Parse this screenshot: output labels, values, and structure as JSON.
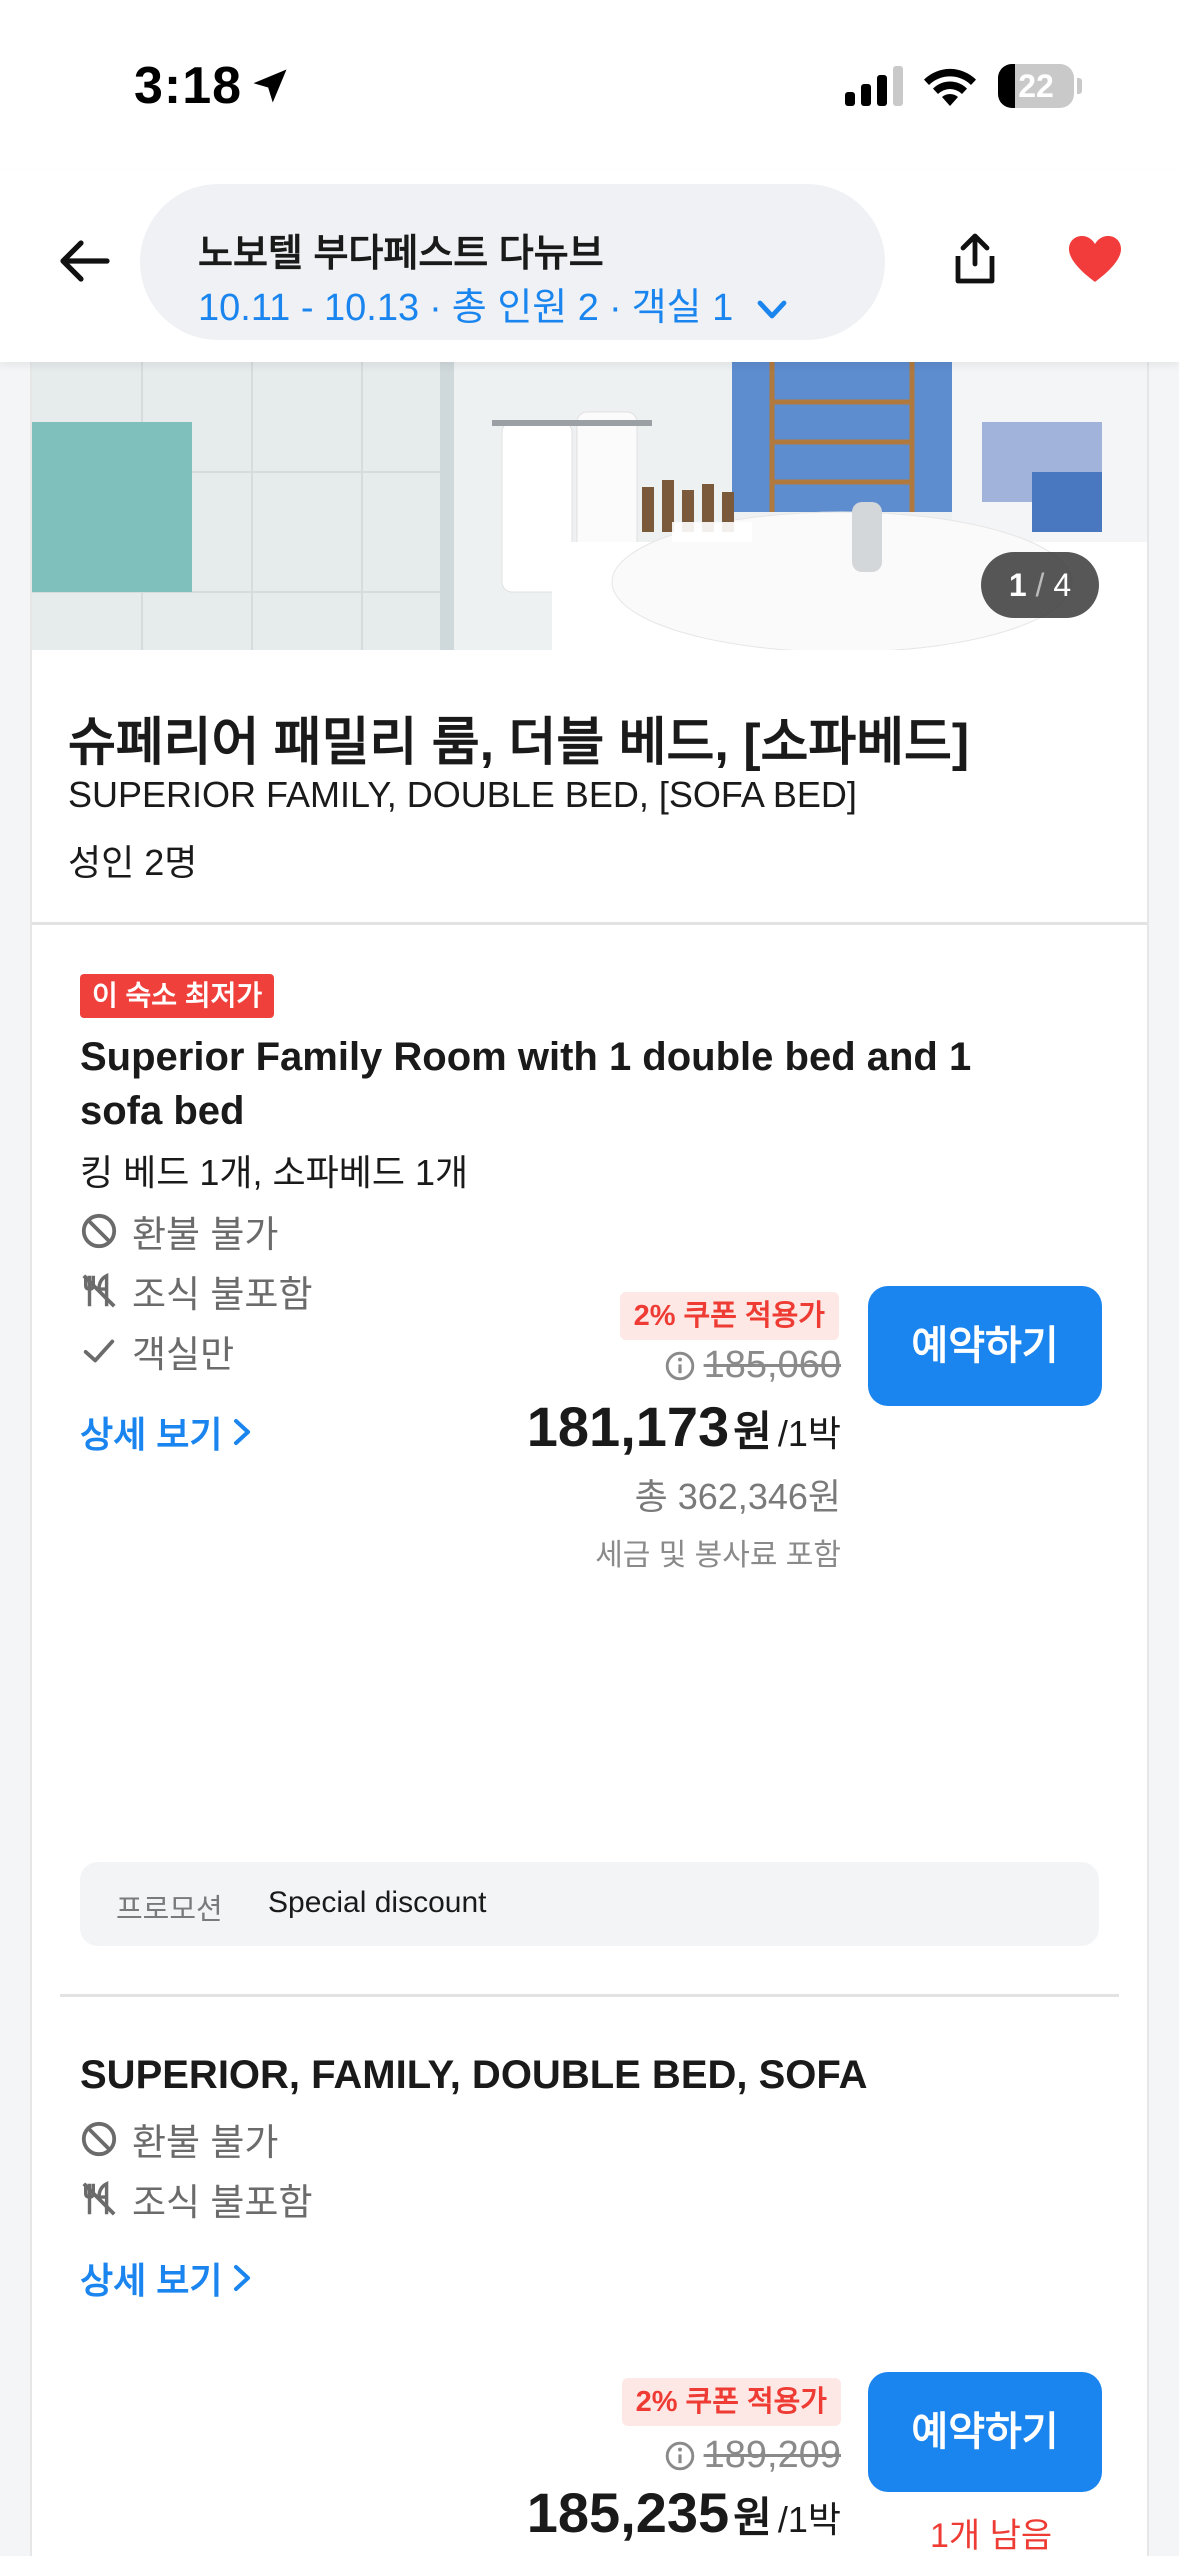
{
  "status_bar": {
    "time": "3:18",
    "battery_level": "22",
    "icons": [
      "location-arrow-icon",
      "signal-icon",
      "wifi-icon",
      "battery-icon"
    ]
  },
  "header": {
    "hotel_name": "노보텔 부다페스트 다뉴브",
    "dates": "10.11 - 10.13",
    "guests": "총 인원 2",
    "rooms": "객실 1",
    "separator": "·",
    "icons": [
      "back-arrow-icon",
      "chevron-down-icon",
      "share-icon",
      "heart-icon"
    ],
    "accent_color": "#1a85ef",
    "heart_color": "#f23b3b"
  },
  "gallery": {
    "current": "1",
    "separator": "/",
    "total": "4"
  },
  "room": {
    "title": "슈페리어 패밀리 룸, 더블 베드, [소파베드]",
    "subtitle": "SUPERIOR FAMILY, DOUBLE BED, [SOFA BED]",
    "occupancy": "성인 2명"
  },
  "offers": [
    {
      "badge": "이 숙소 최저가",
      "title_line1": "Superior Family Room with 1 double bed and 1",
      "title_line2": "sofa bed",
      "beds": "킹 베드 1개, 소파베드 1개",
      "features": [
        {
          "icon": "no-refund-icon",
          "label": "환불 불가"
        },
        {
          "icon": "no-breakfast-icon",
          "label": "조식 불포함"
        },
        {
          "icon": "check-icon",
          "label": "객실만"
        }
      ],
      "detail_label": "상세 보기",
      "coupon_label": "2% 쿠폰 적용가",
      "original_price": "185,060",
      "final_price": "181,173",
      "currency": "원",
      "per_night": "/1박",
      "total": "총 362,346원",
      "tax_note": "세금 및 봉사료 포함",
      "book_label": "예약하기",
      "promo_label": "프로모션",
      "promo_value": "Special discount"
    },
    {
      "title": "SUPERIOR, FAMILY, DOUBLE BED, SOFA",
      "features": [
        {
          "icon": "no-refund-icon",
          "label": "환불 불가"
        },
        {
          "icon": "no-breakfast-icon",
          "label": "조식 불포함"
        }
      ],
      "detail_label": "상세 보기",
      "coupon_label": "2% 쿠폰 적용가",
      "original_price": "189,209",
      "final_price": "185,235",
      "currency": "원",
      "per_night": "/1박",
      "book_label": "예약하기",
      "remaining": "1개 남음"
    }
  ]
}
